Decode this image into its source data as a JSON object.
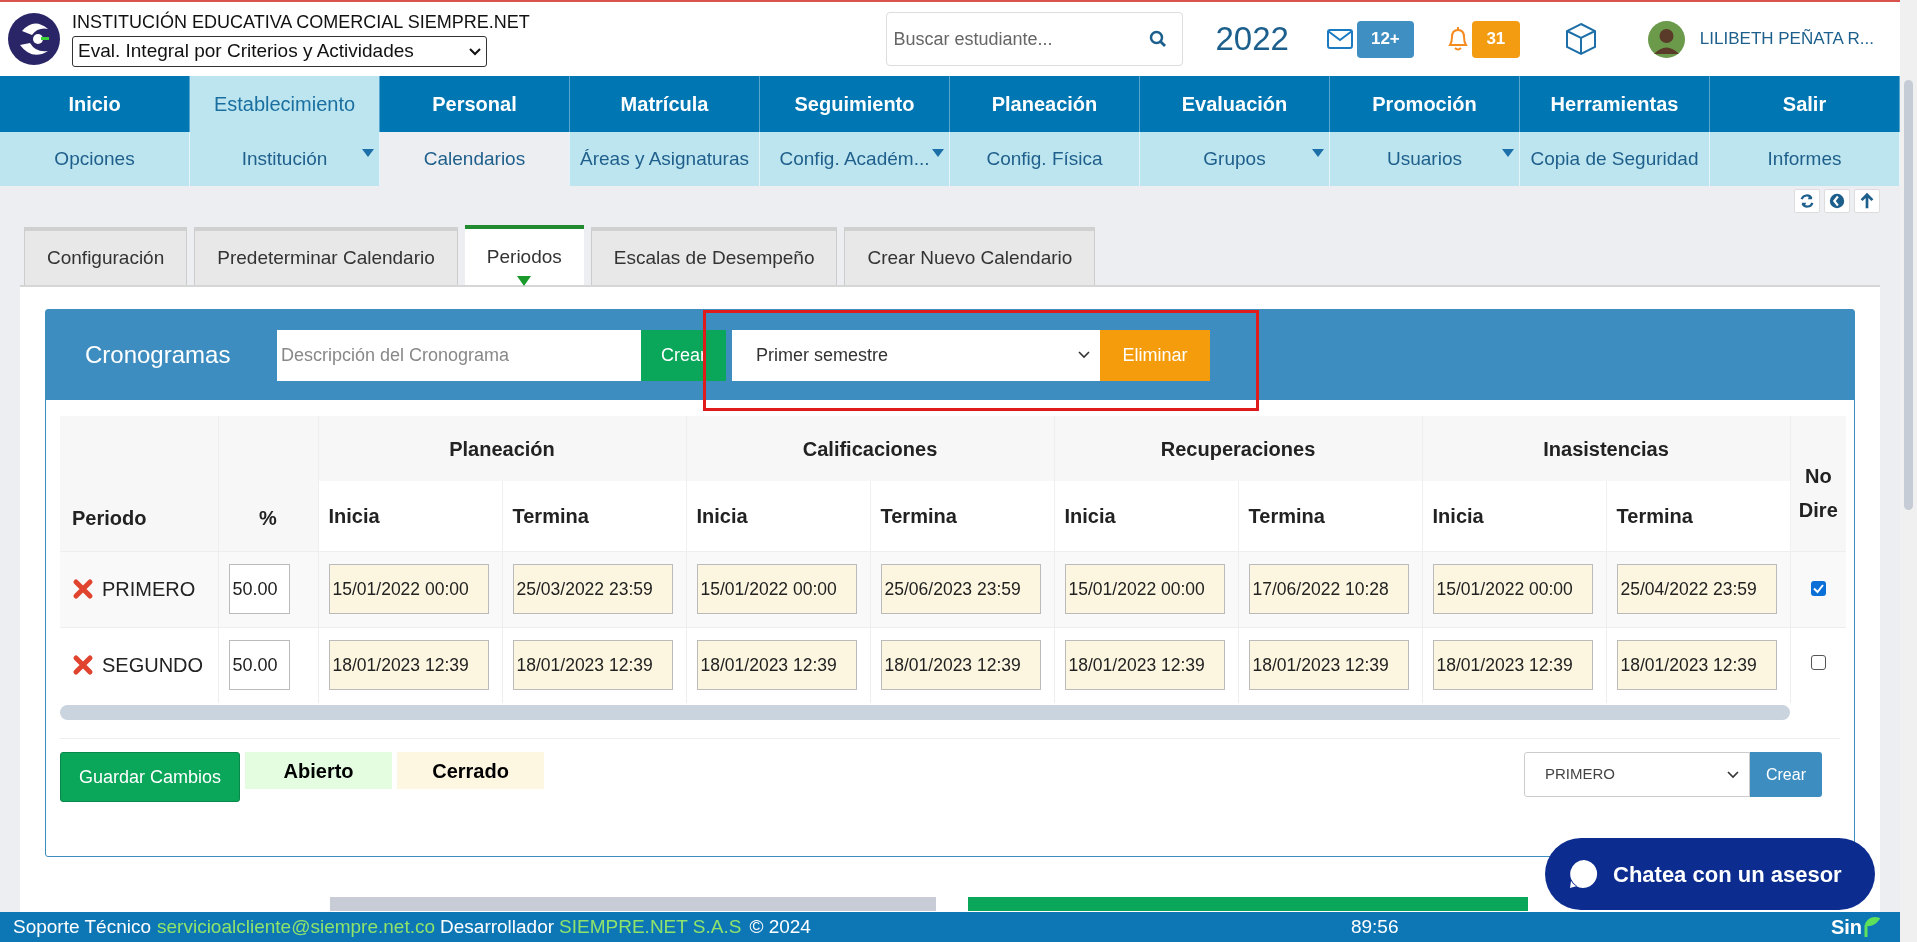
{
  "header": {
    "institution": "INSTITUCIÓN EDUCATIVA COMERCIAL SIEMPRE.NET",
    "program_select": "Eval. Integral por Criterios y Actividades",
    "search_placeholder": "Buscar estudiante...",
    "year": "2022",
    "mail_badge": "12+",
    "bell_badge": "31",
    "user_name": "LILIBETH PEÑATA R..."
  },
  "nav": [
    {
      "label": "Inicio",
      "selected": false,
      "sub": {
        "label": "Opciones",
        "selected": false,
        "has_menu": false
      }
    },
    {
      "label": "Establecimiento",
      "selected": true,
      "sub": {
        "label": "Institución",
        "selected": false,
        "has_menu": true
      }
    },
    {
      "label": "Personal",
      "selected": false,
      "sub": {
        "label": "Calendarios",
        "selected": true,
        "has_menu": false
      }
    },
    {
      "label": "Matrícula",
      "selected": false,
      "sub": {
        "label": "Áreas y Asignaturas",
        "selected": false,
        "has_menu": false
      }
    },
    {
      "label": "Seguimiento",
      "selected": false,
      "sub": {
        "label": "Config. Académ...",
        "selected": false,
        "has_menu": true
      }
    },
    {
      "label": "Planeación",
      "selected": false,
      "sub": {
        "label": "Config. Física",
        "selected": false,
        "has_menu": false
      }
    },
    {
      "label": "Evaluación",
      "selected": false,
      "sub": {
        "label": "Grupos",
        "selected": false,
        "has_menu": true
      }
    },
    {
      "label": "Promoción",
      "selected": false,
      "sub": {
        "label": "Usuarios",
        "selected": false,
        "has_menu": true
      }
    },
    {
      "label": "Herramientas",
      "selected": false,
      "sub": {
        "label": "Copia de Seguridad",
        "selected": false,
        "has_menu": false
      }
    },
    {
      "label": "Salir",
      "selected": false,
      "sub": {
        "label": "Informes",
        "selected": false,
        "has_menu": false
      }
    }
  ],
  "tabs": [
    {
      "label": "Configuración",
      "selected": false
    },
    {
      "label": "Predeterminar Calendario",
      "selected": false
    },
    {
      "label": "Periodos",
      "selected": true
    },
    {
      "label": "Escalas de Desempeño",
      "selected": false
    },
    {
      "label": "Crear Nuevo Calendario",
      "selected": false
    }
  ],
  "cronogramas": {
    "title": "Cronogramas",
    "placeholder": "Descripción del Cronograma",
    "create_button": "Crear",
    "schedule_select": "Primer semestre",
    "delete_button": "Eliminar",
    "highlighted": true
  },
  "table": {
    "period_header": "Periodo",
    "percent_header": "%",
    "groups": [
      {
        "label": "Planeación",
        "columns": [
          "Inicia",
          "Termina"
        ]
      },
      {
        "label": "Calificaciones",
        "columns": [
          "Inicia",
          "Termina"
        ]
      },
      {
        "label": "Recuperaciones",
        "columns": [
          "Inicia",
          "Termina"
        ]
      },
      {
        "label": "Inasistencias",
        "columns": [
          "Inicia",
          "Termina"
        ]
      }
    ],
    "last_header": "No Dire",
    "rows": [
      {
        "name": "PRIMERO",
        "percent": "50.00",
        "dates": [
          "15/01/2022 00:00",
          "25/03/2022 23:59",
          "15/01/2022 00:00",
          "25/06/2023 23:59",
          "15/01/2022 00:00",
          "17/06/2022 10:28",
          "15/01/2022 00:00",
          "25/04/2022 23:59"
        ],
        "checked": true
      },
      {
        "name": "SEGUNDO",
        "percent": "50.00",
        "dates": [
          "18/01/2023 12:39",
          "18/01/2023 12:39",
          "18/01/2023 12:39",
          "18/01/2023 12:39",
          "18/01/2023 12:39",
          "18/01/2023 12:39",
          "18/01/2023 12:39",
          "18/01/2023 12:39"
        ],
        "checked": false
      }
    ]
  },
  "actions": {
    "save_button": "Guardar Cambios",
    "legend": [
      {
        "label": "Abierto",
        "color": "#e4fde0"
      },
      {
        "label": "Cerrado",
        "color": "#fdf7e2"
      }
    ],
    "period_select": "PRIMERO",
    "create_button": "Crear"
  },
  "chat_button": "Chatea con un asesor",
  "footer": {
    "support_label": "Soporte Técnico",
    "email": "servicioalcliente@siempre.net.co",
    "developer_label": "Desarrollador",
    "developer": "SIEMPRE.NET S.A.S",
    "copyright": "© 2024",
    "timer": "89:56",
    "logo": "Sin"
  }
}
